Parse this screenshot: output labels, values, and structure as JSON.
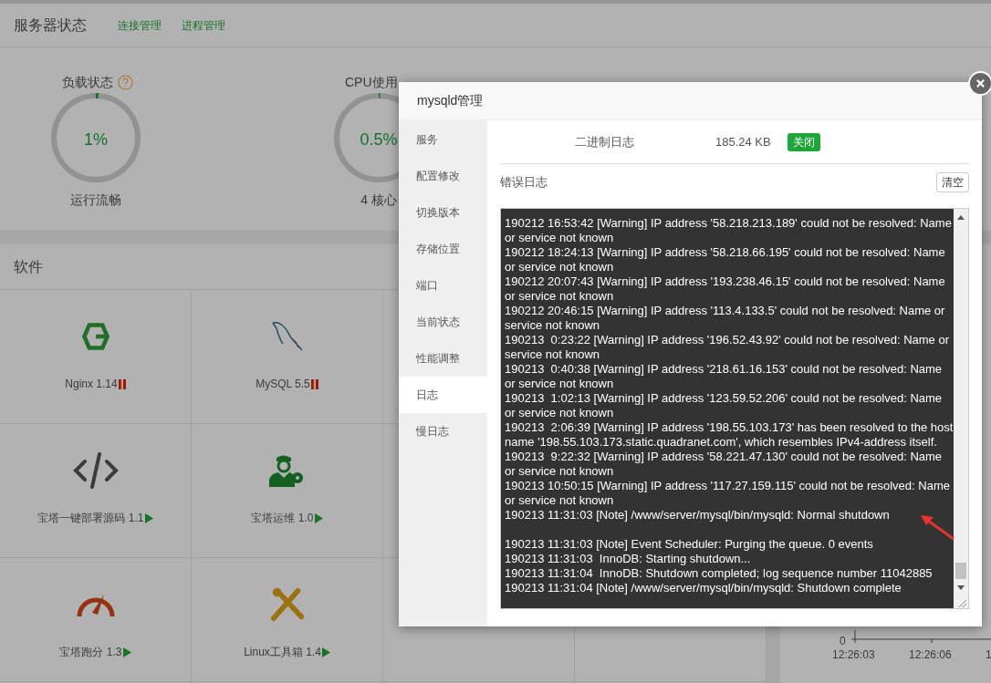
{
  "header": {
    "title": "服务器状态",
    "links": [
      "连接管理",
      "进程管理"
    ]
  },
  "gauges": [
    {
      "label": "负载状态",
      "help": true,
      "value": "1%",
      "level": 0.01,
      "caption": "运行流畅"
    },
    {
      "label": "CPU使用",
      "value": "0.5%",
      "level": 0.005,
      "caption": "4 核心"
    }
  ],
  "software": {
    "title": "软件",
    "items": [
      {
        "name": "Nginx 1.14",
        "running": false
      },
      {
        "name": "MySQL 5.5",
        "running": false
      },
      {
        "name": "宝塔一键部署源码 1.1",
        "running": true
      },
      {
        "name": "宝塔运维 1.0",
        "running": true
      },
      {
        "name": "宝塔跑分 1.3",
        "running": true
      },
      {
        "name": "Linux工具箱 1.4",
        "running": true
      }
    ]
  },
  "chart": {
    "y_tick": "0",
    "x_ticks": [
      "12:26:03",
      "12:26:06",
      "1"
    ]
  },
  "dialog": {
    "title": "mysqld管理",
    "menu": [
      {
        "label": "服务",
        "selected": false
      },
      {
        "label": "配置修改",
        "selected": false
      },
      {
        "label": "切换版本",
        "selected": false
      },
      {
        "label": "存储位置",
        "selected": false
      },
      {
        "label": "端口",
        "selected": false
      },
      {
        "label": "当前状态",
        "selected": false
      },
      {
        "label": "性能调整",
        "selected": false
      },
      {
        "label": "日志",
        "selected": true
      },
      {
        "label": "慢日志",
        "selected": false
      }
    ],
    "binlog": {
      "label": "二进制日志",
      "size": "185.24 KB",
      "button": "关闭"
    },
    "error_log": {
      "label": "错误日志",
      "button": "清空",
      "lines": [
        {
          "text": "190212 16:53:42 [Warning] IP address '58.218.213.189' could not be resolved: Name or service not known",
          "gap_after": false
        },
        {
          "text": "190212 18:24:13 [Warning] IP address '58.218.66.195' could not be resolved: Name or service not known",
          "gap_after": false
        },
        {
          "text": "190212 20:07:43 [Warning] IP address '193.238.46.15' could not be resolved: Name or service not known",
          "gap_after": false
        },
        {
          "text": "190212 20:46:15 [Warning] IP address '113.4.133.5' could not be resolved: Name or service not known",
          "gap_after": false
        },
        {
          "text": "190213  0:23:22 [Warning] IP address '196.52.43.92' could not be resolved: Name or service not known",
          "gap_after": false
        },
        {
          "text": "190213  0:40:38 [Warning] IP address '218.61.16.153' could not be resolved: Name or service not known",
          "gap_after": false
        },
        {
          "text": "190213  1:02:13 [Warning] IP address '123.59.52.206' could not be resolved: Name or service not known",
          "gap_after": false
        },
        {
          "text": "190213  2:06:39 [Warning] IP address '198.55.103.173' has been resolved to the host name '198.55.103.173.static.quadranet.com', which resembles IPv4-address itself.",
          "gap_after": false
        },
        {
          "text": "190213  9:22:32 [Warning] IP address '58.221.47.130' could not be resolved: Name or service not known",
          "gap_after": false
        },
        {
          "text": "190213 10:50:15 [Warning] IP address '117.27.159.115' could not be resolved: Name or service not known",
          "gap_after": false
        },
        {
          "text": "190213 11:31:03 [Note] /www/server/mysql/bin/mysqld: Normal shutdown",
          "gap_after": true
        },
        {
          "text": "190213 11:31:03 [Note] Event Scheduler: Purging the queue. 0 events",
          "gap_after": false
        },
        {
          "text": "190213 11:31:03  InnoDB: Starting shutdown...",
          "gap_after": false
        },
        {
          "text": "190213 11:31:04  InnoDB: Shutdown completed; log sequence number 11042885",
          "gap_after": false
        },
        {
          "text": "190213 11:31:04 [Note] /www/server/mysql/bin/mysqld: Shutdown complete",
          "gap_after": false
        }
      ]
    }
  }
}
